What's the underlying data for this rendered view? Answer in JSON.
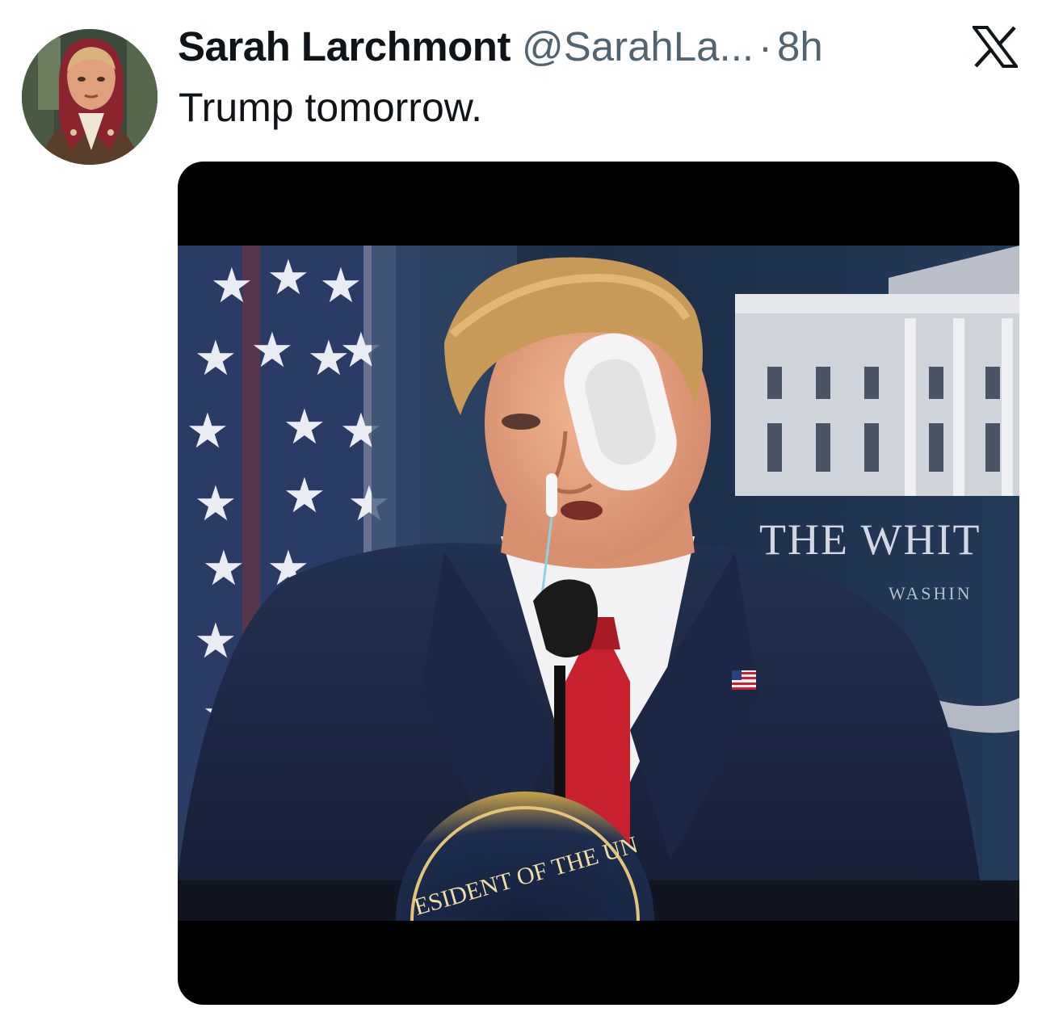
{
  "tweet": {
    "display_name": "Sarah Larchmont",
    "handle": "@SarahLa...",
    "separator": "·",
    "time": "8h",
    "text": "Trump tomorrow."
  },
  "icons": {
    "platform_logo": "x-logo-icon",
    "avatar": "profile-avatar"
  },
  "media": {
    "type": "photo",
    "visible_text": [
      "THE WHIT",
      "WASHIN",
      "ESIDENT OF THE UN"
    ]
  },
  "colors": {
    "text_primary": "#0f1419",
    "text_secondary": "#536471",
    "media_background": "#000000",
    "suit": "#1d2a44",
    "tie": "#c8202c",
    "backdrop": "#1f3552"
  }
}
